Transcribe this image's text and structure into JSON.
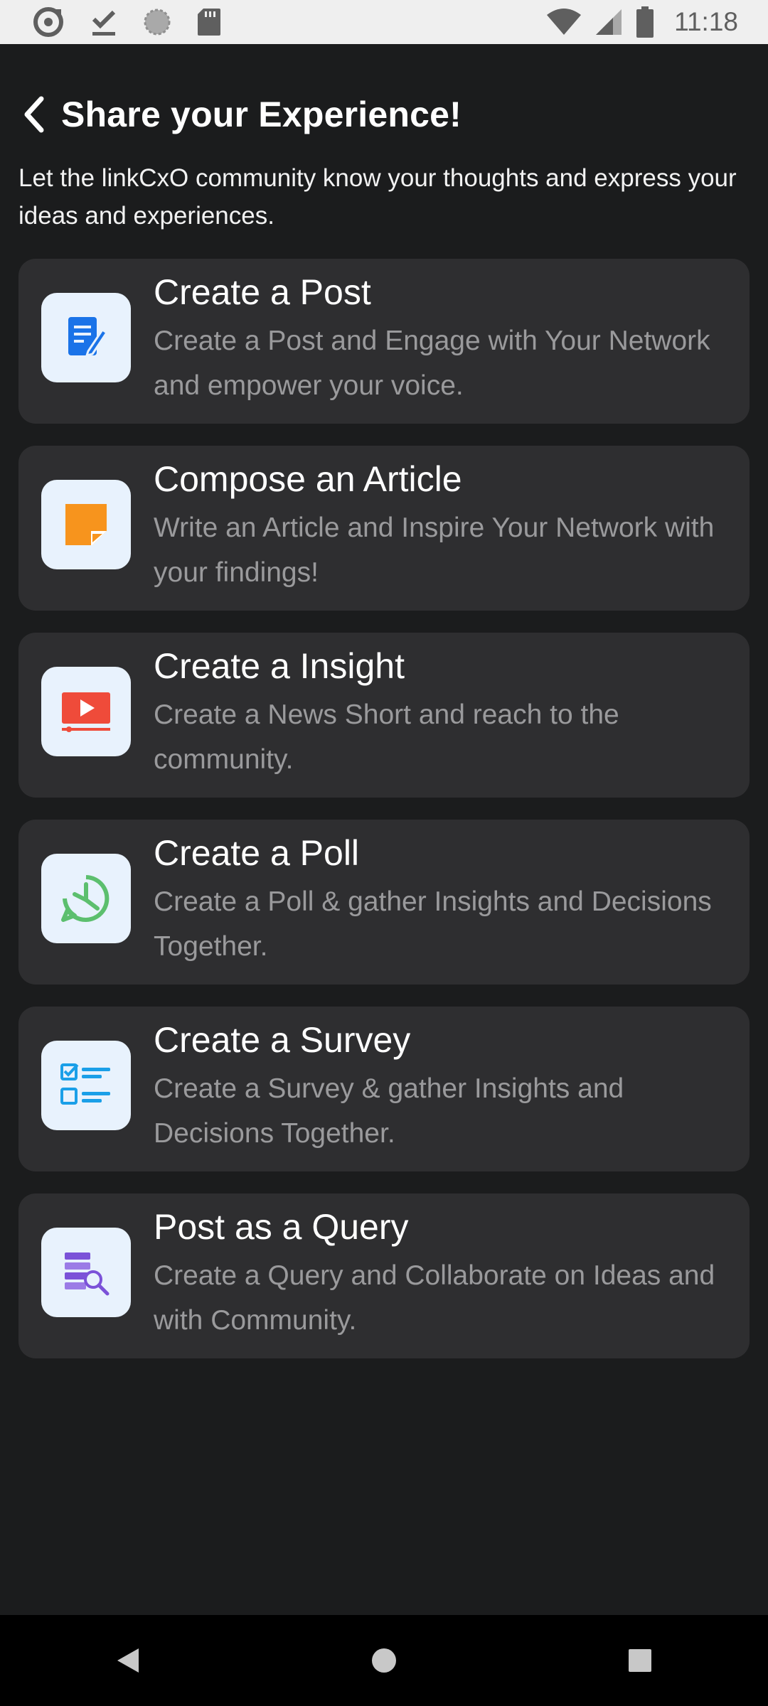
{
  "status_bar": {
    "time": "11:18",
    "left_icons": [
      "sync-icon",
      "download-done-icon",
      "settings-gear-icon",
      "sd-card-icon"
    ],
    "right_icons": [
      "wifi-icon",
      "cellular-signal-icon",
      "battery-icon"
    ]
  },
  "header": {
    "title": "Share your Experience!",
    "back_icon": "chevron-left-icon"
  },
  "intro": "Let the linkCxO community know your thoughts and express your ideas and experiences.",
  "options": [
    {
      "title": "Create a Post",
      "description": "Create a Post and Engage with Your Network and empower your voice.",
      "icon": "edit-document-icon",
      "color": "#1a73e8"
    },
    {
      "title": "Compose an Article",
      "description": "Write an Article and Inspire Your Network with your findings!",
      "icon": "sticky-note-icon",
      "color": "#f7941d"
    },
    {
      "title": "Create a Insight",
      "description": "Create a News Short and reach to the community.",
      "icon": "video-play-icon",
      "color": "#ef4b3a"
    },
    {
      "title": "Create a Poll",
      "description": "Create a Poll & gather Insights and Decisions Together.",
      "icon": "poll-chart-icon",
      "color": "#5cbf6e"
    },
    {
      "title": "Create a Survey",
      "description": "Create a Survey & gather Insights and Decisions Together.",
      "icon": "checklist-icon",
      "color": "#1a9fe8"
    },
    {
      "title": "Post as a Query",
      "description": "Create a Query and Collaborate on Ideas and with Community.",
      "icon": "search-list-icon",
      "color": "#7b52d8"
    }
  ],
  "nav": {
    "back": "nav-back-icon",
    "home": "nav-home-icon",
    "recents": "nav-recents-icon"
  }
}
